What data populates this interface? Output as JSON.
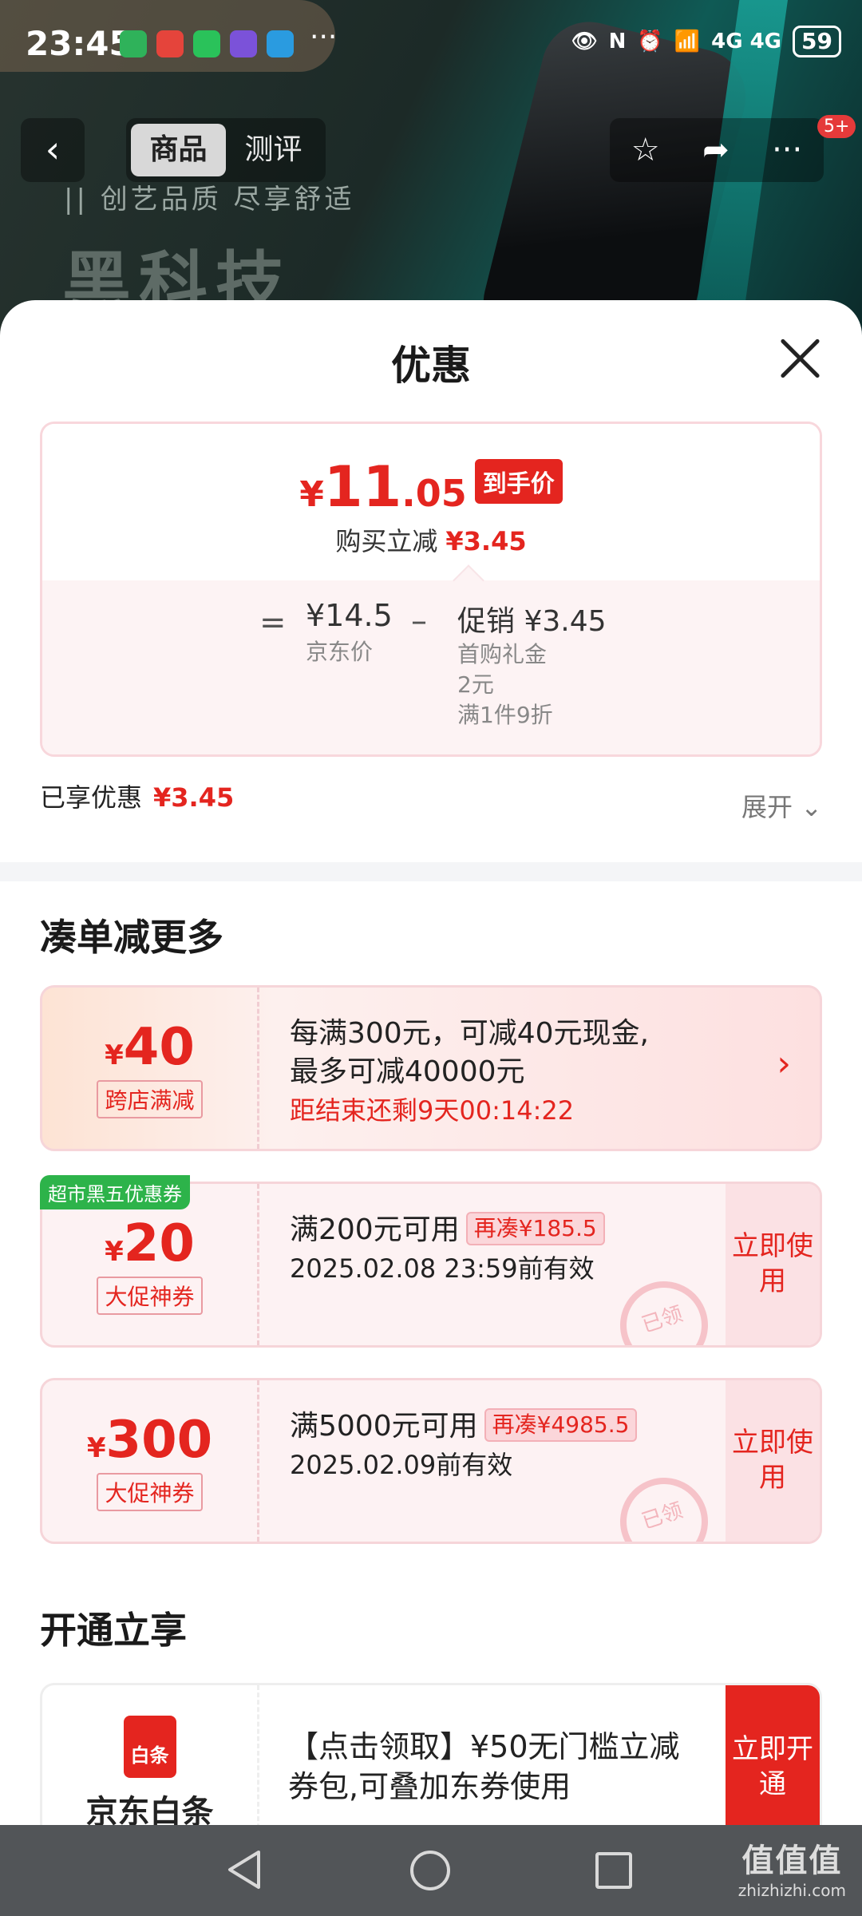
{
  "status_bar": {
    "time": "23:45",
    "network": "4G 4G",
    "battery": "59"
  },
  "header": {
    "tabs": [
      "商品",
      "测评"
    ],
    "active_tab": 0,
    "badge": "5+",
    "slogan": "|| 创艺品质 尽享舒适",
    "banner_text": "黑科技"
  },
  "sheet": {
    "title": "优惠",
    "final_price": {
      "yen": "¥",
      "integer": "11",
      "decimal": ".05",
      "tag": "到手价"
    },
    "instant_reduction": {
      "label": "购买立减",
      "value": "¥3.45"
    },
    "breakdown": {
      "equals": "=",
      "jd_price": "¥14.5",
      "jd_label": "京东价",
      "minus": "–",
      "promo_label": "促销 ¥3.45",
      "promo_items": [
        "首购礼金",
        "2元",
        "满1件9折"
      ]
    },
    "enjoyed": {
      "label": "已享优惠",
      "value": "¥3.45"
    },
    "expand_label": "展开"
  },
  "section_more": {
    "title": "凑单减更多",
    "coupons": [
      {
        "yen": "¥",
        "amount": "40",
        "kind": "跨店满减",
        "line1": "每满300元，可减40元现金,",
        "line2": "最多可减40000元",
        "line3": "距结束还剩9天00:14:22"
      },
      {
        "corner_tag": "超市黑五优惠券",
        "yen": "¥",
        "amount": "20",
        "kind": "大促神券",
        "line1": "满200元可用",
        "chip": "再凑¥185.5",
        "line2": "2025.02.08 23:59前有效",
        "use_label": "立即使用",
        "stamp": "已领"
      },
      {
        "yen": "¥",
        "amount": "300",
        "kind": "大促神券",
        "line1": "满5000元可用",
        "chip": "再凑¥4985.5",
        "line2": "2025.02.09前有效",
        "use_label": "立即使用",
        "stamp": "已领"
      }
    ]
  },
  "section_open": {
    "title": "开通立享",
    "card": {
      "logo_text": "白条",
      "name": "京东白条",
      "text": "【点击领取】¥50无门槛立减券包,可叠加东券使用",
      "button": "立即开通"
    }
  },
  "watermark": {
    "line1": "值值值",
    "line2": "zhizhizhi.com"
  },
  "colors": {
    "accent": "#e4251f",
    "tag_green": "#2db34a"
  }
}
